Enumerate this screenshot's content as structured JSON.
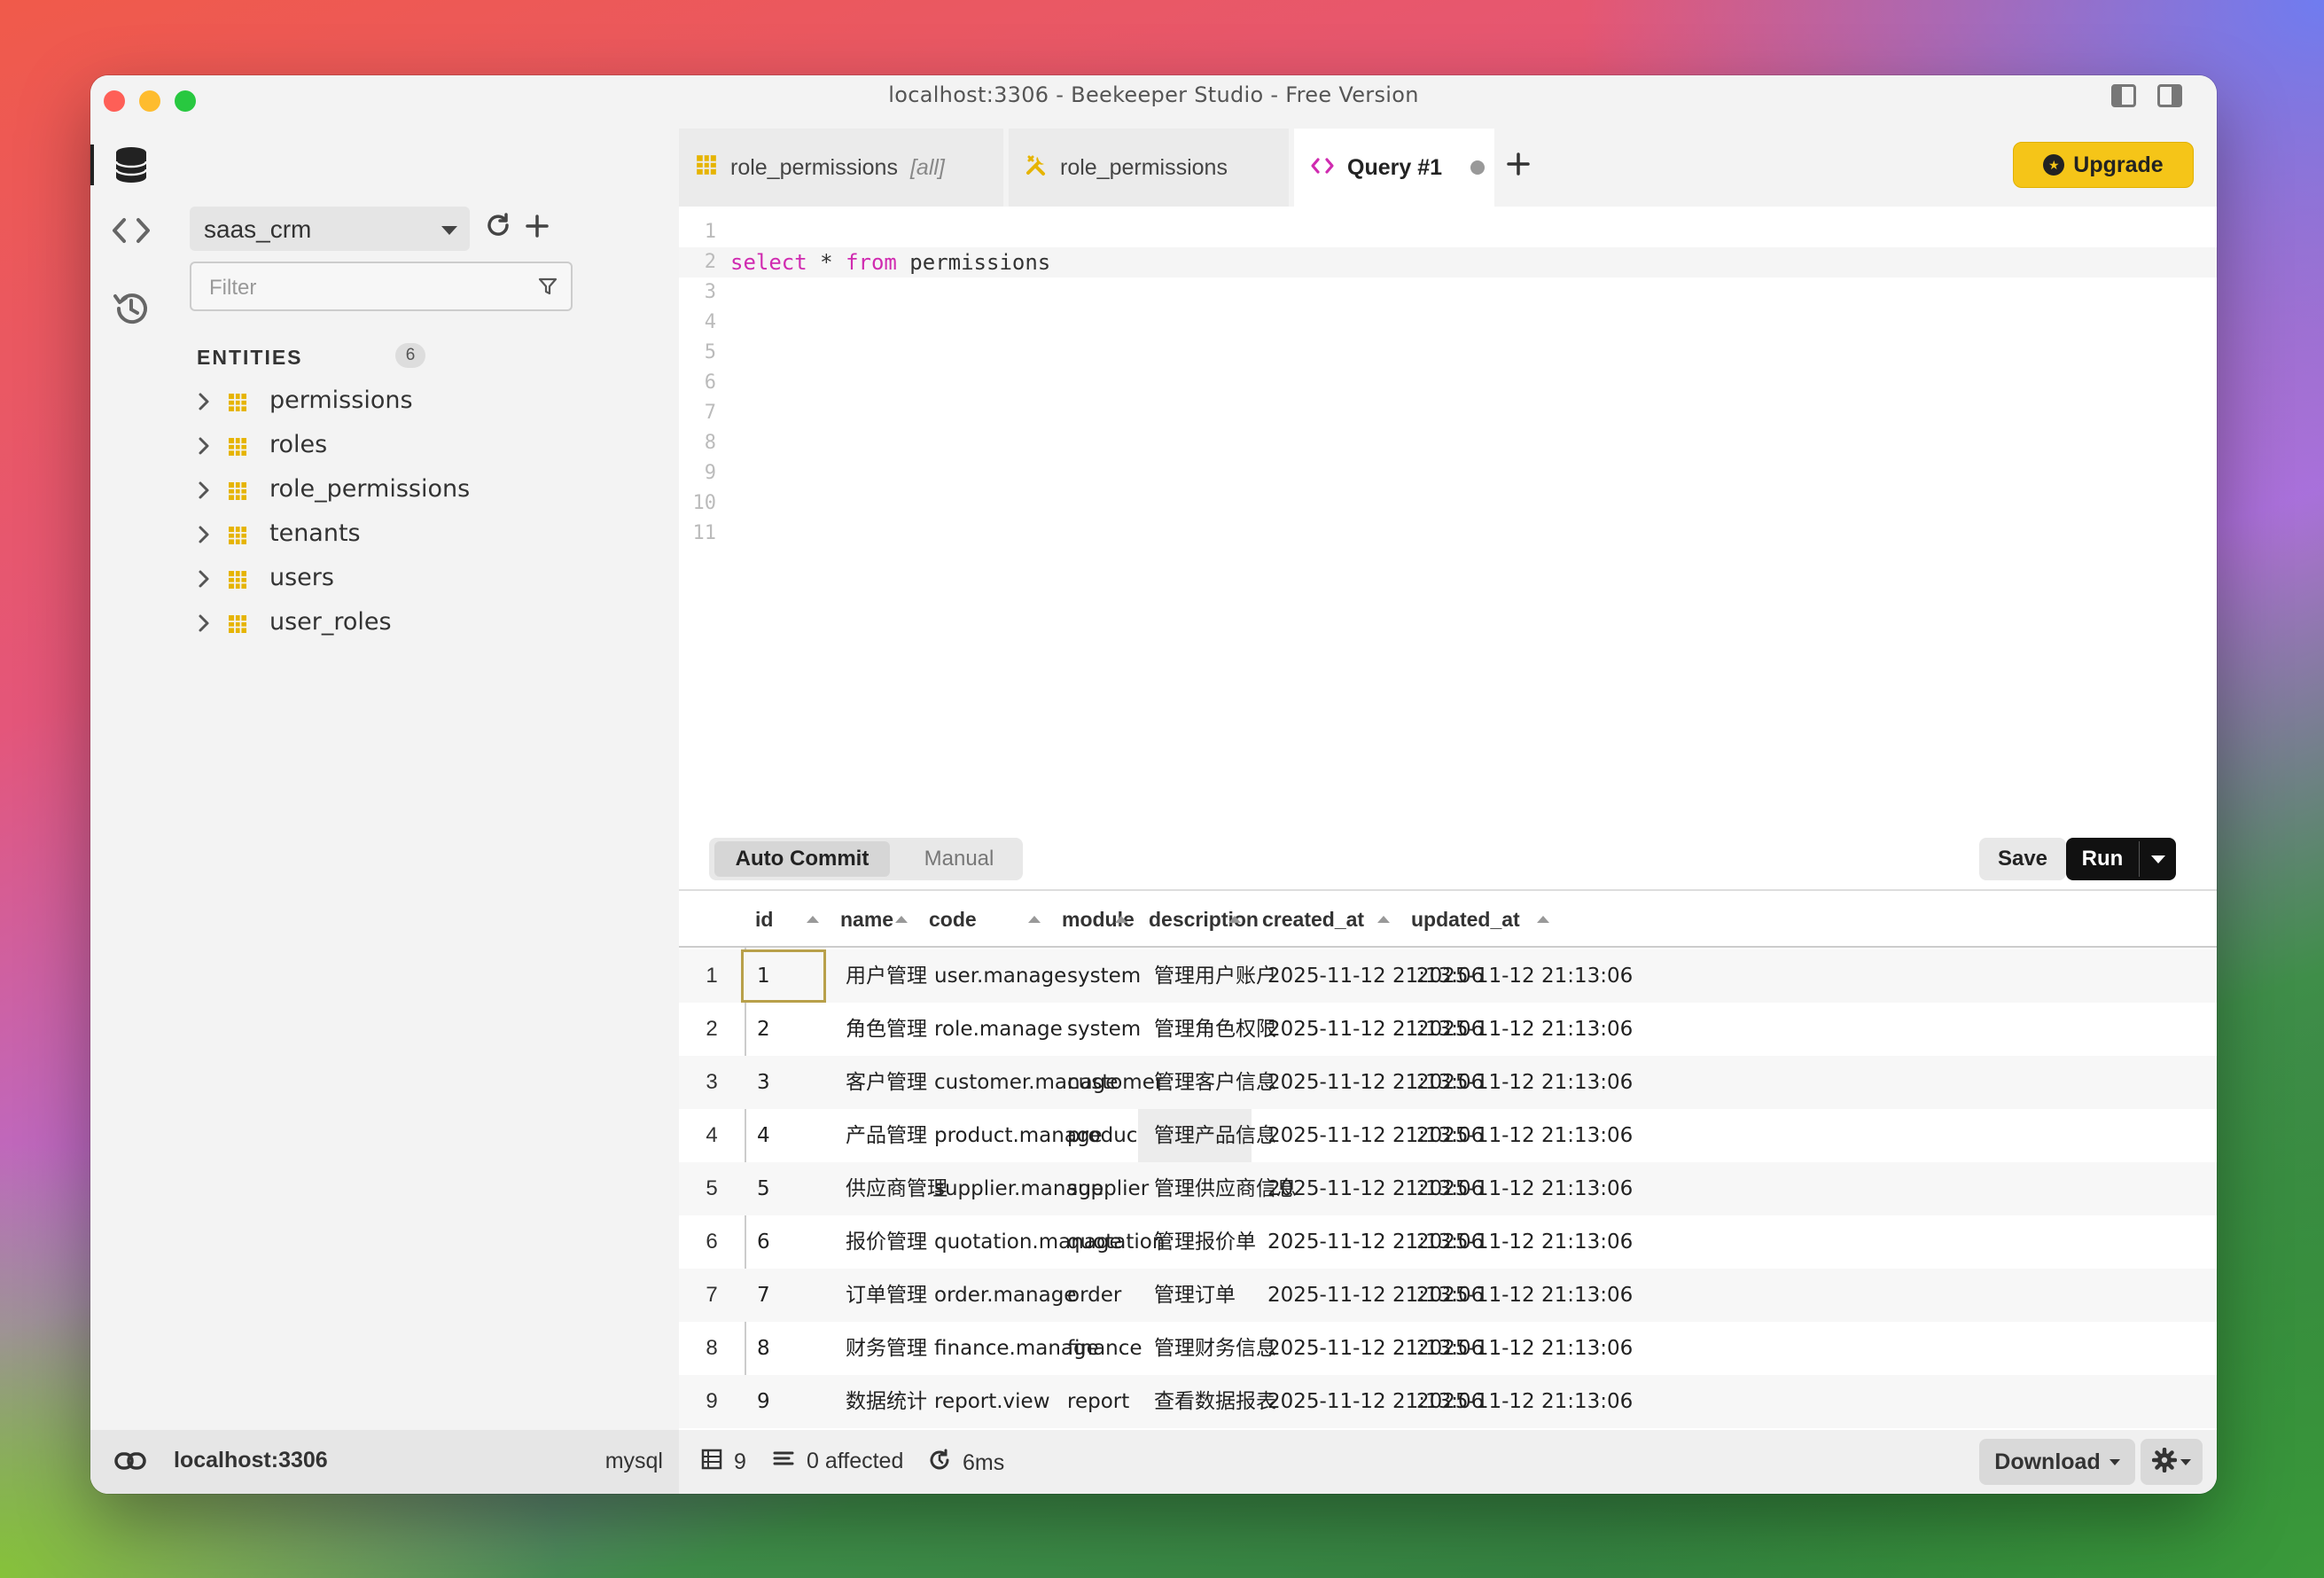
{
  "window": {
    "title": "localhost:3306 - Beekeeper Studio - Free Version"
  },
  "sidebar": {
    "database": "saas_crm",
    "filter_placeholder": "Filter",
    "entities_label": "ENTITIES",
    "entities_count": "6",
    "entities": [
      {
        "label": "permissions"
      },
      {
        "label": "roles"
      },
      {
        "label": "role_permissions"
      },
      {
        "label": "tenants"
      },
      {
        "label": "users"
      },
      {
        "label": "user_roles"
      }
    ]
  },
  "tabs": [
    {
      "label": "role_permissions",
      "suffix": "[all]",
      "icon": "table-icon"
    },
    {
      "label": "role_permissions",
      "icon": "tools-icon"
    },
    {
      "label": "Query #1",
      "icon": "code-icon"
    }
  ],
  "upgrade_label": "Upgrade",
  "editor": {
    "lines": [
      {
        "n": "1",
        "tokens": []
      },
      {
        "n": "2",
        "tokens": [
          {
            "t": "select",
            "kw": true
          },
          {
            "t": " * ",
            "kw": false
          },
          {
            "t": "from",
            "kw": true
          },
          {
            "t": " permissions",
            "kw": false
          }
        ]
      },
      {
        "n": "3",
        "tokens": []
      },
      {
        "n": "4",
        "tokens": []
      },
      {
        "n": "5",
        "tokens": []
      },
      {
        "n": "6",
        "tokens": []
      },
      {
        "n": "7",
        "tokens": []
      },
      {
        "n": "8",
        "tokens": []
      },
      {
        "n": "9",
        "tokens": []
      },
      {
        "n": "10",
        "tokens": []
      },
      {
        "n": "11",
        "tokens": []
      }
    ]
  },
  "toolbar": {
    "auto_commit": "Auto Commit",
    "manual": "Manual",
    "save": "Save",
    "run": "Run"
  },
  "results": {
    "columns": [
      "id",
      "name",
      "code",
      "module",
      "description",
      "created_at",
      "updated_at"
    ],
    "rows": [
      [
        "1",
        "用户管理",
        "user.manage",
        "system",
        "管理用户账户",
        "2025-11-12 21:13:06",
        "2025-11-12 21:13:06"
      ],
      [
        "2",
        "角色管理",
        "role.manage",
        "system",
        "管理角色权限",
        "2025-11-12 21:13:06",
        "2025-11-12 21:13:06"
      ],
      [
        "3",
        "客户管理",
        "customer.manage",
        "customer",
        "管理客户信息",
        "2025-11-12 21:13:06",
        "2025-11-12 21:13:06"
      ],
      [
        "4",
        "产品管理",
        "product.manage",
        "product",
        "管理产品信息",
        "2025-11-12 21:13:06",
        "2025-11-12 21:13:06"
      ],
      [
        "5",
        "供应商管理",
        "supplier.manage",
        "supplier",
        "管理供应商信息",
        "2025-11-12 21:13:06",
        "2025-11-12 21:13:06"
      ],
      [
        "6",
        "报价管理",
        "quotation.manage",
        "quotation",
        "管理报价单",
        "2025-11-12 21:13:06",
        "2025-11-12 21:13:06"
      ],
      [
        "7",
        "订单管理",
        "order.manage",
        "order",
        "管理订单",
        "2025-11-12 21:13:06",
        "2025-11-12 21:13:06"
      ],
      [
        "8",
        "财务管理",
        "finance.manage",
        "finance",
        "管理财务信息",
        "2025-11-12 21:13:06",
        "2025-11-12 21:13:06"
      ],
      [
        "9",
        "数据统计",
        "report.view",
        "report",
        "查看数据报表",
        "2025-11-12 21:13:06",
        "2025-11-12 21:13:06"
      ]
    ]
  },
  "status": {
    "host": "localhost:3306",
    "db_type": "mysql",
    "row_count": "9",
    "affected": "0 affected",
    "time": "6ms",
    "download": "Download"
  },
  "colors": {
    "accent": "#f5c518",
    "keyword": "#d02bb0",
    "table_icon": "#e6b400"
  }
}
